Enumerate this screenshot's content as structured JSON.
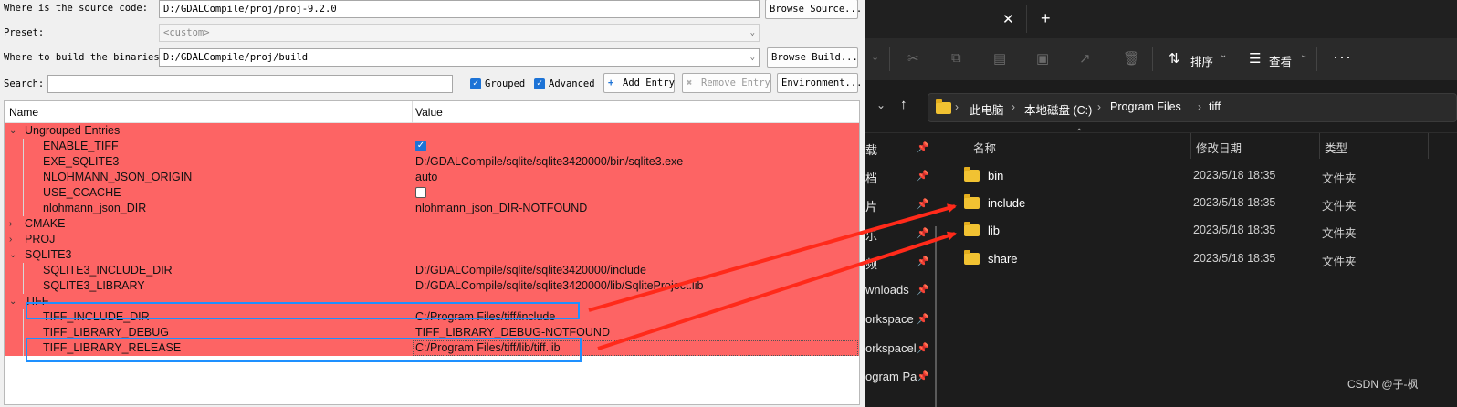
{
  "cmake": {
    "source_label": "Where is the source code:",
    "source_value": "D:/GDALCompile/proj/proj-9.2.0",
    "browse_source": "Browse Source...",
    "preset_label": "Preset:",
    "preset_value": "<custom>",
    "build_label": "Where to build the binaries:",
    "build_value": "D:/GDALCompile/proj/build",
    "browse_build": "Browse Build...",
    "search_label": "Search:",
    "search_value": "",
    "grouped": "Grouped",
    "advanced": "Advanced",
    "add_entry": "Add Entry",
    "remove_entry": "Remove Entry",
    "environment": "Environment...",
    "col_name": "Name",
    "col_value": "Value",
    "rows": [
      {
        "name": "Ungrouped Entries",
        "value": ""
      },
      {
        "name": "ENABLE_TIFF",
        "value": "",
        "checked": true
      },
      {
        "name": "EXE_SQLITE3",
        "value": "D:/GDALCompile/sqlite/sqlite3420000/bin/sqlite3.exe"
      },
      {
        "name": "NLOHMANN_JSON_ORIGIN",
        "value": "auto"
      },
      {
        "name": "USE_CCACHE",
        "value": "",
        "checked": false
      },
      {
        "name": "nlohmann_json_DIR",
        "value": "nlohmann_json_DIR-NOTFOUND"
      },
      {
        "name": "CMAKE",
        "value": ""
      },
      {
        "name": "PROJ",
        "value": ""
      },
      {
        "name": "SQLITE3",
        "value": ""
      },
      {
        "name": "SQLITE3_INCLUDE_DIR",
        "value": "D:/GDALCompile/sqlite/sqlite3420000/include"
      },
      {
        "name": "SQLITE3_LIBRARY",
        "value": "D:/GDALCompile/sqlite/sqlite3420000/lib/SqliteProject.lib"
      },
      {
        "name": "TIFF",
        "value": ""
      },
      {
        "name": "TIFF_INCLUDE_DIR",
        "value": "C:/Program Files/tiff/include"
      },
      {
        "name": "TIFF_LIBRARY_DEBUG",
        "value": "TIFF_LIBRARY_DEBUG-NOTFOUND"
      },
      {
        "name": "TIFF_LIBRARY_RELEASE",
        "value": "C:/Program Files/tiff/lib/tiff.lib"
      }
    ]
  },
  "explorer": {
    "toolbar": {
      "sort": "排序",
      "view": "查看"
    },
    "breadcrumb": [
      "此电脑",
      "本地磁盘 (C:)",
      "Program Files",
      "tiff"
    ],
    "nav_items": [
      "载",
      "档",
      "片",
      "乐",
      "频",
      "wnloads",
      "orkspace",
      "orkspacel",
      "ogram Pa"
    ],
    "columns": {
      "name": "名称",
      "date": "修改日期",
      "type": "类型"
    },
    "files": [
      {
        "name": "bin",
        "date": "2023/5/18 18:35",
        "type": "文件夹"
      },
      {
        "name": "include",
        "date": "2023/5/18 18:35",
        "type": "文件夹"
      },
      {
        "name": "lib",
        "date": "2023/5/18 18:35",
        "type": "文件夹"
      },
      {
        "name": "share",
        "date": "2023/5/18 18:35",
        "type": "文件夹"
      }
    ]
  },
  "watermark": "CSDN @子-枫",
  "colors": {
    "row_red": "#fd6464",
    "highlight": "#1e90ff",
    "arrow": "#ff2a1a",
    "folder": "#f1c232"
  }
}
